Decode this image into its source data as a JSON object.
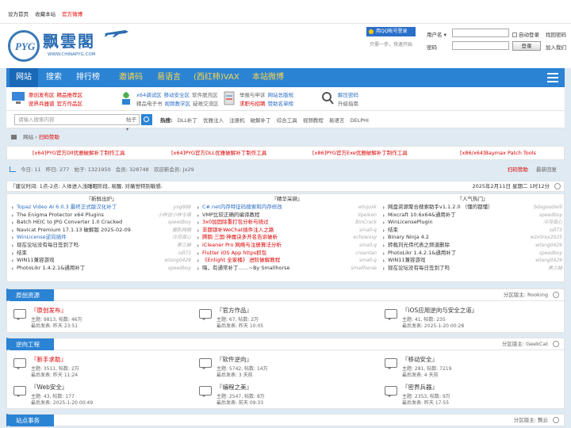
{
  "topbar": {
    "home": "设为首页",
    "fav": "收藏本站",
    "weibo": "官方微博"
  },
  "logo": {
    "seal": "PYG",
    "name": "飘雲閣",
    "url": "WWW.CHINAPYG.COM"
  },
  "login": {
    "qq_label": "用QQ帐号登录",
    "quick_tip": "只需一步，快速开始",
    "user_label": "用户名",
    "user_sel": "▾",
    "pass_label": "密码",
    "auto_login": "自动登录",
    "forgot": "找回密码",
    "login_btn": "登录",
    "join": "加入我们"
  },
  "nav": {
    "items": [
      "网站",
      "搜索",
      "排行榜",
      "邀请码",
      "易语言",
      "(西红柿)VAX",
      "本站微博"
    ]
  },
  "quick": [
    {
      "line1": [
        "原创发布区",
        "精品推荐区"
      ],
      "line2": [
        "密界兵器谱",
        "官方作品区"
      ],
      "color": "#d00"
    },
    {
      "line1": [
        "x64调试区",
        "移动安全区",
        "软件脱壳区"
      ],
      "line2": [
        "精品电子书",
        "视频教学区",
        "疑难交流区"
      ],
      "color": "#2b6cc4"
    },
    {
      "line1": [
        "举报与申诉",
        "网站总版规"
      ],
      "line2": [
        "求职与招聘",
        "赞助名单榜"
      ],
      "color": "#333"
    },
    {
      "line1": [
        "解压密码"
      ],
      "line2": [
        "升级指南"
      ],
      "color": "#333"
    }
  ],
  "search": {
    "placeholder": "请输入搜索内容",
    "scope": "帖子 ▾",
    "hot_label": "热搜:",
    "hot": [
      "DLL补丁",
      "优雅注入",
      "注册机",
      "破解补丁",
      "综合工具",
      "视频教程",
      "易语言",
      "DELPHI"
    ]
  },
  "breadcrumb": {
    "a": "网站",
    "b": "扫码赞助"
  },
  "ads": [
    "[x64]PYG官方Dll优雅破解补丁制作工具",
    "[x64]PYG官方DLL优雅破解补丁制作工具",
    "[x86]PYG官方Exe优雅破解补丁制作工具",
    "[x86/x64]Baymax Patch Tools"
  ],
  "stats": {
    "today": "今日: 11",
    "yesterday": "昨日: 277",
    "posts": "帖子: 1321950",
    "members": "会员: 328748",
    "newest": "欢迎新会员: Jx29",
    "sponsor": "扫码赞助",
    "latest": "最新回复"
  },
  "notice": {
    "text": "『建议时间: 1点-2点: 人体进入浅睡眠阶段, 易醒, 对痛觉特别敏感.",
    "date": "2025年2月11日 星期二 1时12分"
  },
  "columns": [
    {
      "title": "『新鲜出炉』",
      "rows": [
        {
          "t": "Topaz Video AI 6.0.3 最终正式版汉化补丁",
          "a": "yxg888",
          "c": "#2b6cc4"
        },
        {
          "t": "The Enigma Protector x64 Plugins",
          "a": "小样这小样令琢",
          "c": "#333"
        },
        {
          "t": "Batch HEIC to JPG Converter 1.0 Cracked",
          "a": "speedboy",
          "c": "#333"
        },
        {
          "t": "Navicat Premium 17.1.13 破解版 2025-02-09",
          "a": "魔影网络",
          "c": "#333"
        },
        {
          "t": "WinLicense逆向插件",
          "a": "冷月孤心",
          "c": "#2b6cc4"
        },
        {
          "t": "现在论坛没有每日签到了吗",
          "a": "黑兰赫",
          "c": "#333"
        },
        {
          "t": "结束",
          "a": "sdl73",
          "c": "#333"
        },
        {
          "t": "WIN11兼容游戏",
          "a": "wtang0429",
          "c": "#333"
        },
        {
          "t": "PhotoLikr 1.4.2.1&通用补丁",
          "a": "speedboy",
          "c": "#333"
        }
      ]
    },
    {
      "title": "『精华采撷』",
      "rows": [
        {
          "t": "C#.net内存特征码搜索和内存修改",
          "a": "wtujoxk",
          "c": "#2b6cc4"
        },
        {
          "t": "VMP比较正确的编译教程",
          "a": "lipeiken",
          "c": "#333"
        },
        {
          "t": "3x0加固除重打包分析与绕过",
          "a": "BinCrack",
          "c": "#d00"
        },
        {
          "t": "非题锁补WeChat插件注入之路",
          "a": "small-q",
          "c": "#d00"
        },
        {
          "t": "腾鹅·三国·神魔诀多开名告诉破析",
          "a": "echowxsy",
          "c": "#d00"
        },
        {
          "t": "iCleaner Pro 网络与注册算法分析",
          "a": "small-q",
          "c": "#d00"
        },
        {
          "t": "Flutter iOS App https抓包",
          "a": "creantan",
          "c": "#d00"
        },
        {
          "t": "《Enlight 全家桶》 进阶破解教程",
          "a": "small-q",
          "c": "#d00"
        },
        {
          "t": "嗨，有通常补丁……~By Smallhorse",
          "a": "smallhorse",
          "c": "#333"
        }
      ]
    },
    {
      "title": "『人气热门』",
      "rows": [
        {
          "t": "网盘资源聚合搜索助手v1.1.2.0 （懂的都懂）",
          "a": "bdsgoodwill",
          "c": "#333"
        },
        {
          "t": "Mixcraft 10.6x64&通用补丁",
          "a": "speedboy",
          "c": "#333"
        },
        {
          "t": "WinLicensePlugin",
          "a": "冷月孤心",
          "c": "#333"
        },
        {
          "t": "结束",
          "a": "sdl73",
          "c": "#333"
        },
        {
          "t": "Binary Ninja 4.2",
          "a": "wzx0rex2025",
          "c": "#333"
        },
        {
          "t": "转载刘光伟代表之频道删除",
          "a": "wtang0429",
          "c": "#333"
        },
        {
          "t": "PhotoLikr 1.4.2.1&通用补丁",
          "a": "speedboy",
          "c": "#333"
        },
        {
          "t": "WIN11兼容游戏",
          "a": "wtang0429",
          "c": "#333"
        },
        {
          "t": "现在论坛没有每日签到了吗",
          "a": "黑兰赫",
          "c": "#333"
        }
      ]
    }
  ],
  "sections": [
    {
      "title": "原创资源",
      "mod": "分区版主: Rooking",
      "boards": [
        {
          "name": "『原创发布』",
          "stats": "主题: 9813, 帖数: 46万",
          "last": "最后发表: 昨天 23:51",
          "red": true
        },
        {
          "name": "『官方作品』",
          "stats": "主题: 67, 帖数: 2万",
          "last": "最后发表: 昨天 10:05",
          "red": false
        },
        {
          "name": "『iOS应用逆向与安全之道』",
          "stats": "主题: 41, 帖数: 235",
          "last": "最后发表: 2025-1-20 00:28",
          "red": false
        }
      ]
    },
    {
      "title": "逆向工程",
      "mod": "分区版主: GeekCat",
      "boards": [
        {
          "name": "『新手求助』",
          "stats": "主题: 3511, 帖数: 2万",
          "last": "最后发表: 昨天 11:24",
          "red": true
        },
        {
          "name": "『软件逆向』",
          "stats": "主题: 5742, 帖数: 14万",
          "last": "最后发表: 3 天前",
          "red": false
        },
        {
          "name": "『移动安全』",
          "stats": "主题: 281, 帖数: 7219",
          "last": "最后发表: 4 天前",
          "red": false
        },
        {
          "name": "『Web安全』",
          "stats": "主题: 43, 帖数: 177",
          "last": "最后发表: 2025-1-20 00:49",
          "red": false
        },
        {
          "name": "『编程之美』",
          "stats": "主题: 2547, 帖数: 8万",
          "last": "最后发表: 前天 09:33",
          "red": false
        },
        {
          "name": "『密界兵器』",
          "stats": "主题: 2353, 帖数: 9万",
          "last": "最后发表: 昨天 17:55",
          "red": false
        }
      ]
    },
    {
      "title": "站点事务",
      "mod": "分区版主: 飘云",
      "boards": []
    }
  ]
}
